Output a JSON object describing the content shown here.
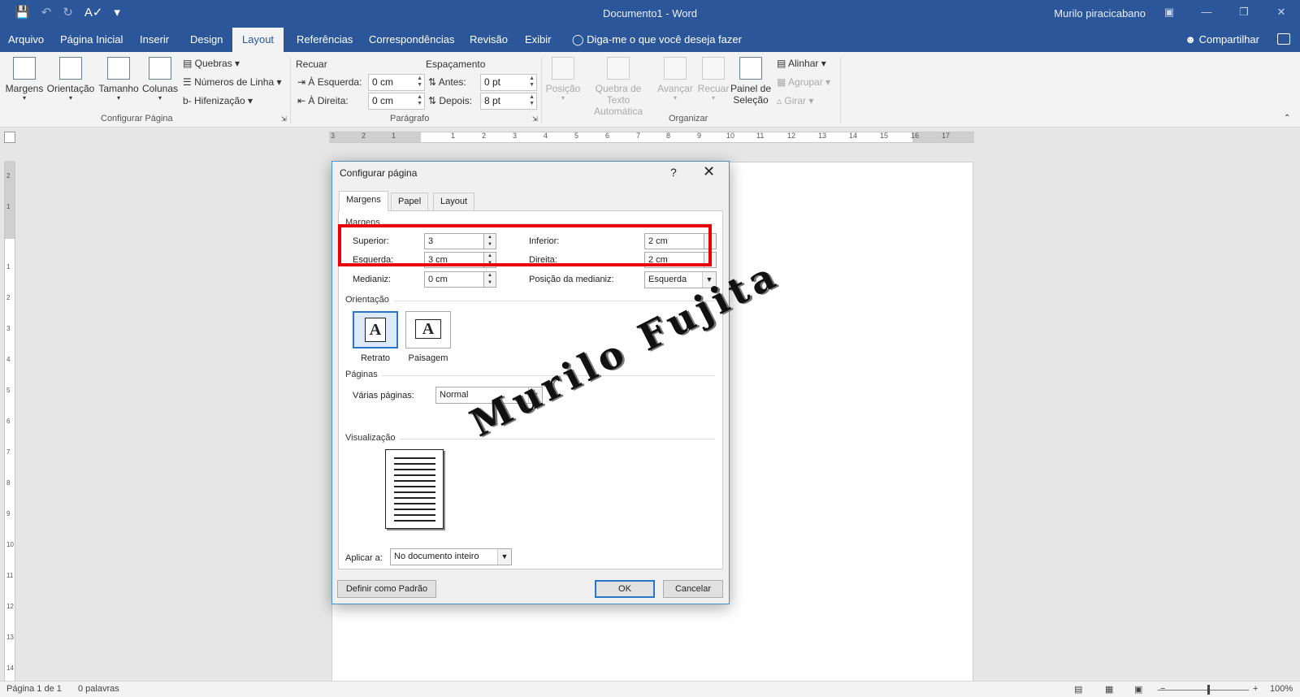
{
  "window": {
    "title": "Documento1  -  Word",
    "user": "Murilo piracicabano"
  },
  "tabs": [
    "Arquivo",
    "Página Inicial",
    "Inserir",
    "Design",
    "Layout",
    "Referências",
    "Correspondências",
    "Revisão",
    "Exibir"
  ],
  "active_tab": "Layout",
  "tell_me": "Diga-me o que você deseja fazer",
  "share": "Compartilhar",
  "ribbon": {
    "page_setup": {
      "margins": "Margens",
      "orientation": "Orientação",
      "size": "Tamanho",
      "columns": "Colunas",
      "breaks": "Quebras",
      "line_numbers": "Números de Linha",
      "hyphenation": "Hifenização",
      "group_label": "Configurar Página"
    },
    "paragraph": {
      "indent_label": "Recuar",
      "spacing_label": "Espaçamento",
      "left_label": "À Esquerda:",
      "left_value": "0 cm",
      "right_label": "À Direita:",
      "right_value": "0 cm",
      "before_label": "Antes:",
      "before_value": "0 pt",
      "after_label": "Depois:",
      "after_value": "8 pt",
      "group_label": "Parágrafo"
    },
    "arrange": {
      "position": "Posição",
      "wrap_text": "Quebra de Texto Automática",
      "bring_forward": "Avançar",
      "send_backward": "Recuar",
      "selection_pane": "Painel de Seleção",
      "align": "Alinhar",
      "group": "Agrupar",
      "rotate": "Girar",
      "group_label": "Organizar"
    }
  },
  "ruler": {
    "h_numbers": [
      "3",
      "2",
      "1",
      "1",
      "2",
      "3",
      "4",
      "5",
      "6",
      "7",
      "8",
      "9",
      "10",
      "11",
      "12",
      "13",
      "14",
      "15",
      "16",
      "17"
    ],
    "v_numbers": [
      "2",
      "1",
      "1",
      "2",
      "3",
      "4",
      "5",
      "6",
      "7",
      "8",
      "9",
      "10",
      "11",
      "12",
      "13",
      "14"
    ]
  },
  "dialog": {
    "title": "Configurar página",
    "help": "?",
    "tabs": [
      "Margens",
      "Papel",
      "Layout"
    ],
    "margins_section": "Margens",
    "top_label": "Superior:",
    "top_value": "3",
    "bottom_label": "Inferior:",
    "bottom_value": "2 cm",
    "left_label": "Esquerda:",
    "left_value": "3 cm",
    "right_label": "Direita:",
    "right_value": "2 cm",
    "gutter_label": "Medianiz:",
    "gutter_value": "0 cm",
    "gutter_pos_label": "Posição da medianiz:",
    "gutter_pos_value": "Esquerda",
    "orientation_section": "Orientação",
    "portrait": "Retrato",
    "landscape": "Paisagem",
    "pages_section": "Páginas",
    "multiple_pages_label": "Várias páginas:",
    "multiple_pages_value": "Normal",
    "preview_section": "Visualização",
    "apply_to_label": "Aplicar a:",
    "apply_to_value": "No documento inteiro",
    "set_default": "Definir como Padrão",
    "ok": "OK",
    "cancel": "Cancelar"
  },
  "watermark_text": "Murilo Fujita",
  "status": {
    "page": "Página 1 de 1",
    "words": "0 palavras",
    "zoom": "100%"
  },
  "colors": {
    "brand": "#2b579a",
    "highlight": "#e8000b",
    "accent": "#2a77c9"
  }
}
